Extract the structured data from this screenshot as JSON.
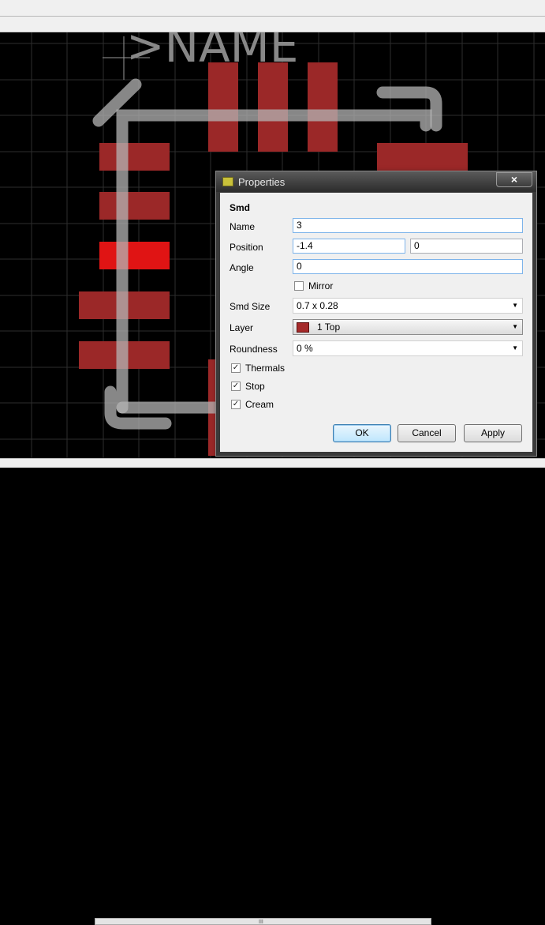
{
  "canvas": {
    "name_label": ">NAME",
    "colors": {
      "background": "#000000",
      "grid": "#333333",
      "pad": "#9b2828",
      "pad_selected": "#e01414",
      "outline": "#a9a9a9"
    }
  },
  "dialog": {
    "title": "Properties",
    "close_label": "×",
    "section": "Smd",
    "name_label": "Name",
    "name_value": "3",
    "position_label": "Position",
    "position_x": "-1.4",
    "position_y": "0",
    "angle_label": "Angle",
    "angle_value": "0",
    "mirror_label": "Mirror",
    "mirror_checked": false,
    "smd_size_label": "Smd Size",
    "smd_size_value": "0.7 x 0.28",
    "layer_label": "Layer",
    "layer_value": "1 Top",
    "layer_color": "#a52a2a",
    "roundness_label": "Roundness",
    "roundness_value": "0 %",
    "thermals_label": "Thermals",
    "thermals_checked": true,
    "stop_label": "Stop",
    "stop_checked": true,
    "cream_label": "Cream",
    "cream_checked": true,
    "ok_label": "OK",
    "cancel_label": "Cancel",
    "apply_label": "Apply"
  },
  "scrollbar": {
    "grip_label": "III"
  }
}
